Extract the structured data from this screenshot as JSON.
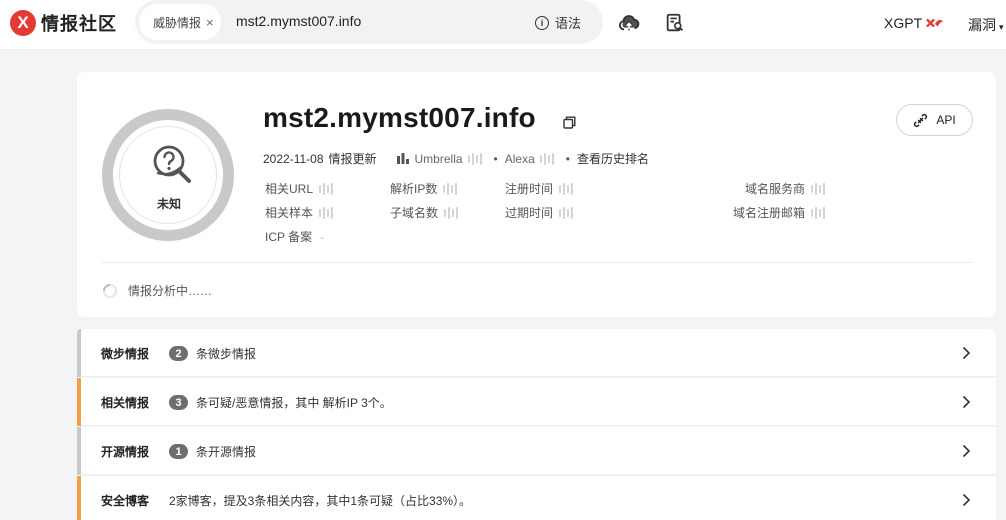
{
  "brand": {
    "logo_letter": "X",
    "name": "情报社区",
    "accent": "#e53935"
  },
  "search": {
    "chip_label": "威胁情报",
    "chip_close": "×",
    "query": "mst2.mymst007.info",
    "syntax_label": "语法"
  },
  "toolbar": {
    "upload_icon": "cloud-upload-icon",
    "report_icon": "report-search-icon",
    "xgpt_label": "XGPT",
    "vuln_label": "漏洞"
  },
  "summary": {
    "verdict": "未知",
    "domain": "mst2.mymst007.info",
    "api_label": "API",
    "updated_date": "2022-11-08",
    "updated_label": "情报更新",
    "umbrella_label": "Umbrella",
    "alexa_label": "Alexa",
    "history_rank_label": "查看历史排名",
    "fields": {
      "related_url": "相关URL",
      "resolved_ip_count": "解析IP数",
      "register_time": "注册时间",
      "registrar": "域名服务商",
      "related_samples": "相关样本",
      "subdomain_count": "子域名数",
      "expire_time": "过期时间",
      "registrant_email": "域名注册邮箱",
      "icp_label": "ICP 备案",
      "icp_value": "-"
    },
    "loading_text": "情报分析中……"
  },
  "sections": [
    {
      "title": "微步情报",
      "count": "2",
      "desc": "条微步情报",
      "stripe": "#c8c8c8"
    },
    {
      "title": "相关情报",
      "count": "3",
      "desc": "条可疑/恶意情报，其中 解析IP 3个。",
      "stripe": "#f0a04b"
    },
    {
      "title": "开源情报",
      "count": "1",
      "desc": "条开源情报",
      "stripe": "#c8c8c8"
    },
    {
      "title": "安全博客",
      "count": "",
      "desc": "2家博客，提及3条相关内容，其中1条可疑（占比33%）。",
      "stripe": "#f0a04b"
    }
  ]
}
